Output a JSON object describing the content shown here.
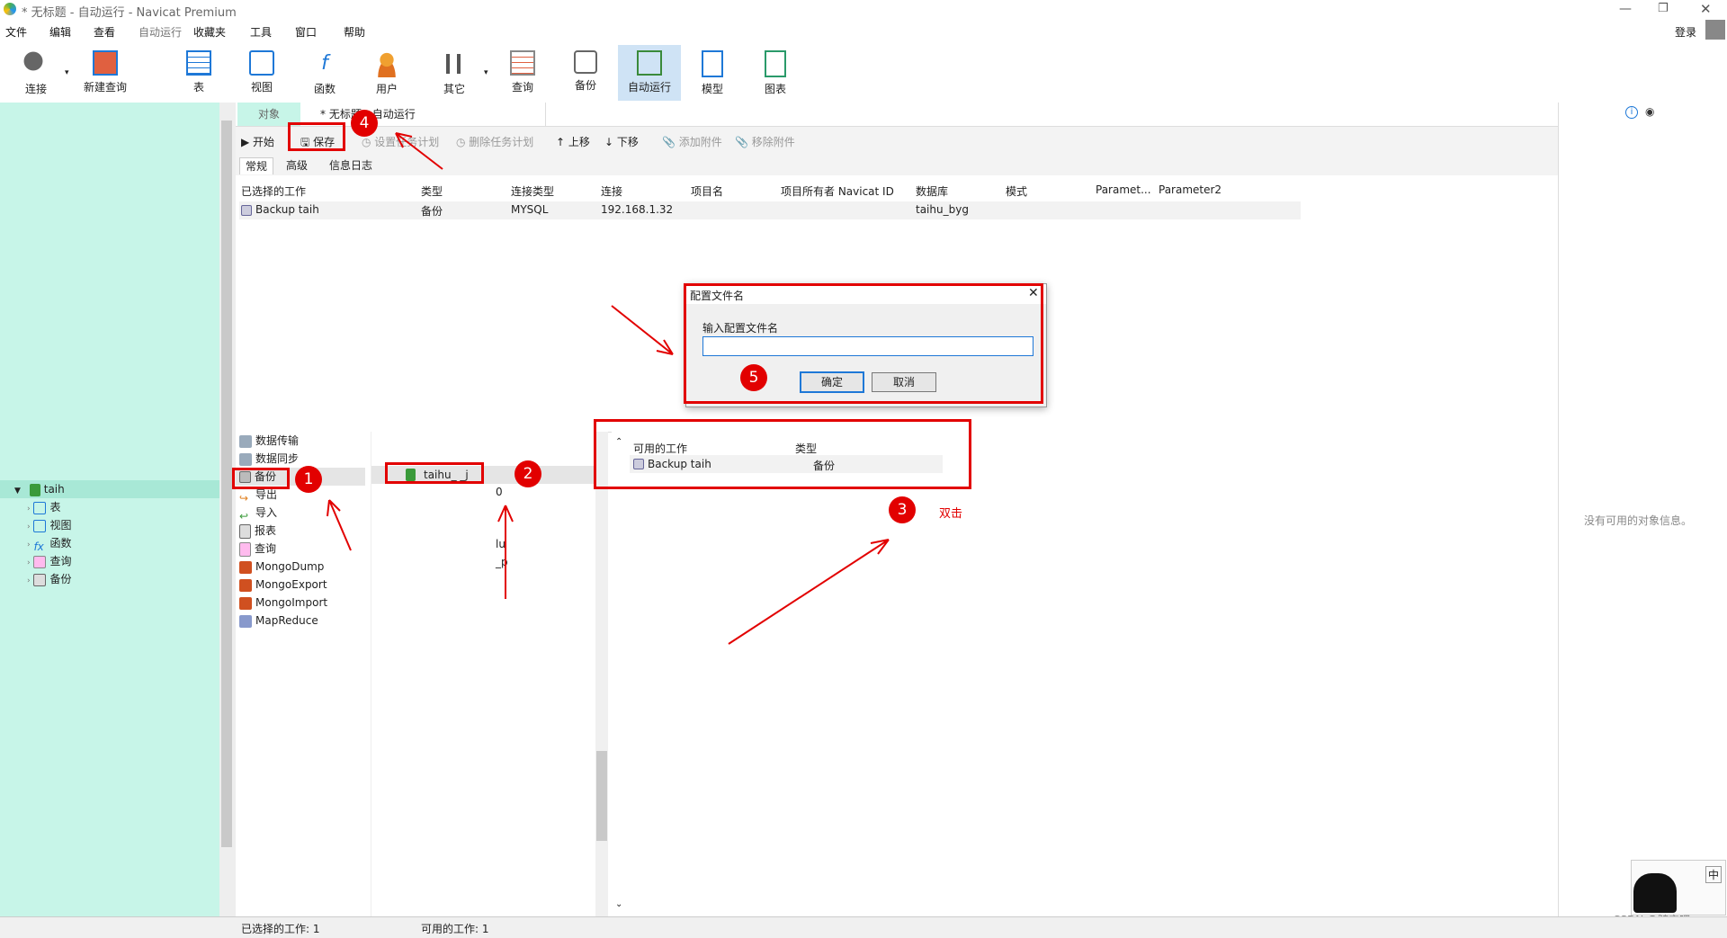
{
  "window": {
    "title": "* 无标题 - 自动运行 - Navicat Premium",
    "login_label": "登录"
  },
  "menu": [
    "文件",
    "编辑",
    "查看",
    "自动运行",
    "收藏夹",
    "工具",
    "窗口",
    "帮助"
  ],
  "toolbar": [
    "连接",
    "新建查询",
    "表",
    "视图",
    "函数",
    "用户",
    "其它",
    "查询",
    "备份",
    "自动运行",
    "模型",
    "图表"
  ],
  "tabs": {
    "objects": "对象",
    "current": "* 无标题 - 自动运行"
  },
  "actions": {
    "start": "开始",
    "save": "保存",
    "set_task": "设置任务计划",
    "del_task": "删除任务计划",
    "up": "上移",
    "down": "下移",
    "add_attach": "添加附件",
    "remove_attach": "移除附件"
  },
  "subtabs": [
    "常规",
    "高级",
    "信息日志"
  ],
  "grid": {
    "headers": [
      "已选择的工作",
      "类型",
      "连接类型",
      "连接",
      "项目名",
      "项目所有者 Navicat ID",
      "数据库",
      "模式",
      "Paramet...",
      "Parameter2"
    ],
    "row": [
      "Backup taih",
      "备份",
      "MYSQL",
      "192.168.1.32",
      "",
      "",
      "taihu_byg",
      "",
      "",
      ""
    ]
  },
  "nav_tree": {
    "root": "taih",
    "children": [
      "表",
      "视图",
      "函数",
      "查询",
      "备份"
    ]
  },
  "job_types": [
    "数据传输",
    "数据同步",
    "备份",
    "导出",
    "导入",
    "报表",
    "查询",
    "MongoDump",
    "MongoExport",
    "MongoImport",
    "MapReduce"
  ],
  "mid": {
    "db": "taihu_ _j",
    "zero": "0",
    "lu": "lu",
    "p": "_p"
  },
  "available": {
    "headers": [
      "可用的工作",
      "类型"
    ],
    "row": [
      "Backup taih",
      "备份"
    ]
  },
  "info": {
    "no_info": "没有可用的对象信息。"
  },
  "dialog": {
    "title": "配置文件名",
    "label": "输入配置文件名",
    "value": "",
    "ok": "确定",
    "cancel": "取消"
  },
  "annotations": {
    "b1": "1",
    "b2": "2",
    "b3": "3",
    "b4": "4",
    "b5": "5",
    "dblclick": "双击"
  },
  "status": {
    "selected": "已选择的工作: 1",
    "available": "可用的工作: 1"
  },
  "watermark": "CSDN @随它吧",
  "ime": "中",
  "colors": {
    "nav_bg": "#c7f5e8",
    "accent": "#1e78d7",
    "annot": "#e20000"
  }
}
